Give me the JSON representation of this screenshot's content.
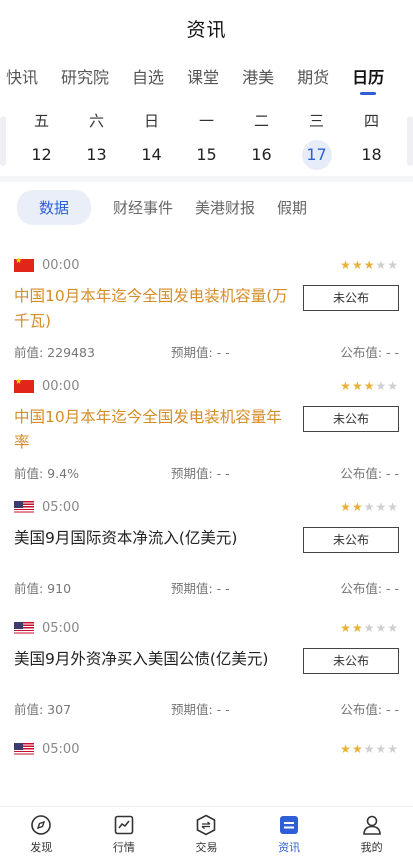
{
  "header": {
    "title": "资讯"
  },
  "tabs": [
    {
      "label": "快讯"
    },
    {
      "label": "研究院"
    },
    {
      "label": "自选"
    },
    {
      "label": "课堂"
    },
    {
      "label": "港美"
    },
    {
      "label": "期货"
    },
    {
      "label": "日历"
    }
  ],
  "week": {
    "dows": [
      "五",
      "六",
      "日",
      "一",
      "二",
      "三",
      "四"
    ],
    "days": [
      "12",
      "13",
      "14",
      "15",
      "16",
      "17",
      "18"
    ],
    "selected_day": "17"
  },
  "subtabs": [
    {
      "label": "数据"
    },
    {
      "label": "财经事件"
    },
    {
      "label": "美港财报"
    },
    {
      "label": "假期"
    }
  ],
  "events": [
    {
      "flag": "cn",
      "time": "00:00",
      "stars": 3,
      "name": "中国10月本年迄今全国发电装机容量(万千瓦)",
      "highlight": true,
      "status": "未公布",
      "prev": "前值: 229483",
      "forecast": "预期值: - -",
      "published": "公布值: - -"
    },
    {
      "flag": "cn",
      "time": "00:00",
      "stars": 3,
      "name": "中国10月本年迄今全国发电装机容量年率",
      "highlight": true,
      "status": "未公布",
      "prev": "前值: 9.4%",
      "forecast": "预期值: - -",
      "published": "公布值: - -"
    },
    {
      "flag": "us",
      "time": "05:00",
      "stars": 2,
      "name": "美国9月国际资本净流入(亿美元)",
      "highlight": false,
      "status": "未公布",
      "prev": "前值: 910",
      "forecast": "预期值: - -",
      "published": "公布值: - -"
    },
    {
      "flag": "us",
      "time": "05:00",
      "stars": 2,
      "name": "美国9月外资净买入美国公债(亿美元)",
      "highlight": false,
      "status": "未公布",
      "prev": "前值: 307",
      "forecast": "预期值: - -",
      "published": "公布值: - -"
    },
    {
      "flag": "us",
      "time": "05:00",
      "stars": 2,
      "name": "",
      "highlight": false,
      "status": "",
      "prev": "",
      "forecast": "",
      "published": ""
    }
  ],
  "bottom_nav": [
    {
      "label": "发现",
      "icon": "compass-icon"
    },
    {
      "label": "行情",
      "icon": "chart-icon"
    },
    {
      "label": "交易",
      "icon": "trade-icon"
    },
    {
      "label": "资讯",
      "icon": "news-icon"
    },
    {
      "label": "我的",
      "icon": "profile-icon"
    }
  ],
  "colors": {
    "accent": "#2f5fd8",
    "highlight": "#d48d28",
    "star": "#e8b13a"
  }
}
